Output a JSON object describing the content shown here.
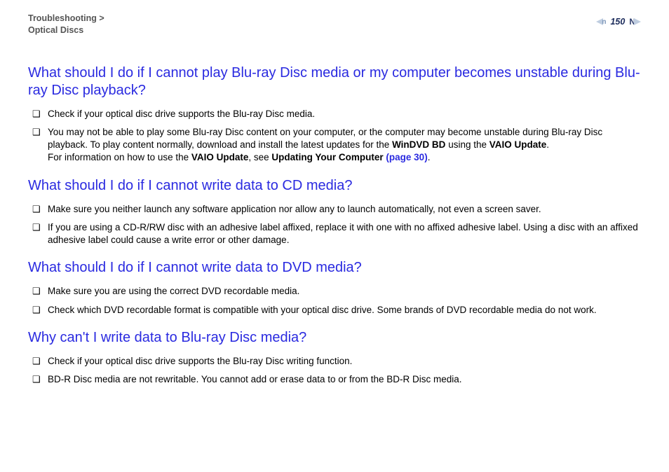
{
  "header": {
    "breadcrumb_top": "Troubleshooting",
    "breadcrumb_sep": ">",
    "breadcrumb_bottom": "Optical Discs",
    "page_number": "150",
    "letter_N": "N",
    "letter_n": "n"
  },
  "sections": {
    "s1": {
      "title": "What should I do if I cannot play Blu-ray Disc media or my computer becomes unstable during Blu-ray Disc playback?",
      "b1": "Check if your optical disc drive supports the Blu-ray Disc media.",
      "b2_pre": "You may not be able to play some Blu-ray Disc content on your computer, or the computer may become unstable during Blu-ray Disc playback. To play content normally, download and install the latest updates for the ",
      "b2_bold1": "WinDVD BD",
      "b2_mid1": " using the ",
      "b2_bold2": "VAIO Update",
      "b2_end1": ".",
      "b2_break": "\n",
      "b2_line2_pre": "For information on how to use the ",
      "b2_line2_bold1": "VAIO Update",
      "b2_line2_mid": ", see ",
      "b2_line2_bold2": "Updating Your Computer ",
      "b2_line2_link": "(page 30)",
      "b2_line2_end": "."
    },
    "s2": {
      "title": "What should I do if I cannot write data to CD media?",
      "b1": "Make sure you neither launch any software application nor allow any to launch automatically, not even a screen saver.",
      "b2": "If you are using a CD-R/RW disc with an adhesive label affixed, replace it with one with no affixed adhesive label. Using a disc with an affixed adhesive label could cause a write error or other damage."
    },
    "s3": {
      "title": "What should I do if I cannot write data to DVD media?",
      "b1": "Make sure you are using the correct DVD recordable media.",
      "b2": "Check which DVD recordable format is compatible with your optical disc drive. Some brands of DVD recordable media do not work."
    },
    "s4": {
      "title": "Why can't I write data to Blu-ray Disc media?",
      "b1": "Check if your optical disc drive supports the Blu-ray Disc writing function.",
      "b2": "BD-R Disc media are not rewritable. You cannot add or erase data to or from the BD-R Disc media."
    }
  },
  "bullet_marker": "❑"
}
